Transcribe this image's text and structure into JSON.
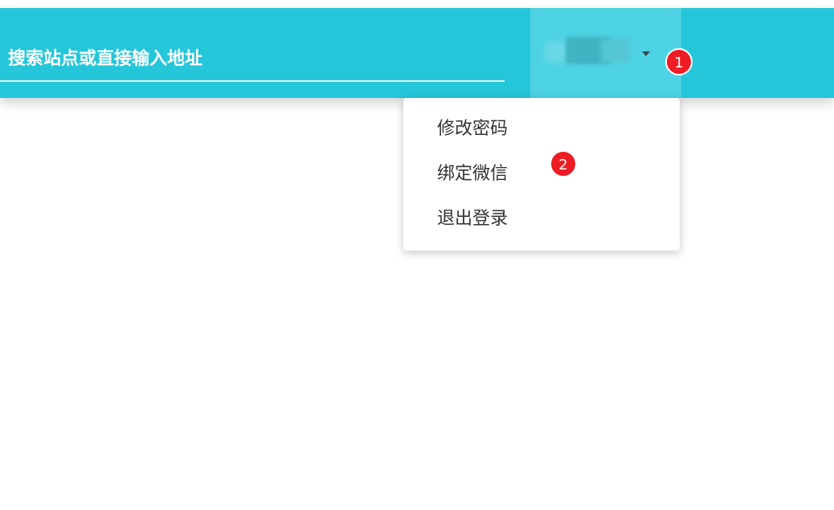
{
  "header": {
    "search": {
      "placeholder": "搜索站点或直接输入地址"
    },
    "user_menu": {
      "icon": "chevron-down-icon"
    }
  },
  "dropdown": {
    "items": [
      {
        "label": "修改密码"
      },
      {
        "label": "绑定微信"
      },
      {
        "label": "退出登录"
      }
    ]
  },
  "annotations": [
    {
      "label": "1"
    },
    {
      "label": "2"
    }
  ],
  "colors": {
    "header_bg": "#26c6da",
    "user_menu_bg": "#4dd3e3",
    "badge_bg": "#ee1c25",
    "menu_text": "#333333"
  }
}
